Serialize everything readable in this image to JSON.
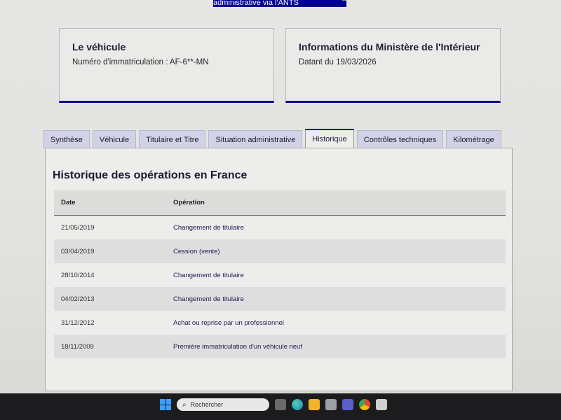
{
  "top_button": {
    "label": "Obtenir le Certificat de situation administrative via l'ANTS"
  },
  "vehicle_card": {
    "title": "Le véhicule",
    "plate_text": "Numéro d'immatriculation : AF-6**-MN"
  },
  "ministry_card": {
    "title": "Informations du Ministère de l'Intérieur",
    "date_text": "Datant du 19/03/2026"
  },
  "tabs": [
    {
      "label": "Synthèse"
    },
    {
      "label": "Véhicule"
    },
    {
      "label": "Titulaire et Titre"
    },
    {
      "label": "Situation administrative"
    },
    {
      "label": "Historique",
      "active": true
    },
    {
      "label": "Contrôles techniques"
    },
    {
      "label": "Kilométrage"
    }
  ],
  "history": {
    "title": "Historique des opérations en France",
    "columns": {
      "date": "Date",
      "operation": "Opération"
    },
    "rows": [
      {
        "date": "21/05/2019",
        "operation": "Changement de titulaire"
      },
      {
        "date": "03/04/2019",
        "operation": "Cession (vente)"
      },
      {
        "date": "28/10/2014",
        "operation": "Changement de titulaire"
      },
      {
        "date": "04/02/2013",
        "operation": "Changement de titulaire"
      },
      {
        "date": "31/12/2012",
        "operation": "Achat ou reprise par un professionnel"
      },
      {
        "date": "18/11/2009",
        "operation": "Première immatriculation d'un véhicule neuf"
      }
    ]
  },
  "taskbar": {
    "search_placeholder": "Rechercher"
  },
  "colors": {
    "accent": "#000091",
    "tab_bg": "#d1d2e6",
    "taskbar": "#1c1c1f"
  }
}
